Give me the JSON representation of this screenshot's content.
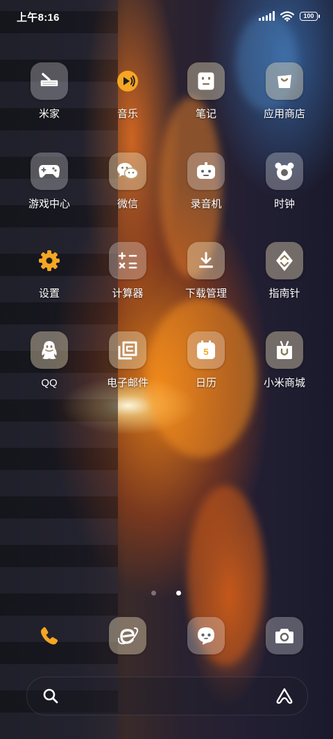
{
  "status_bar": {
    "time": "上午8:16",
    "battery": "100"
  },
  "apps": [
    {
      "label": "米家",
      "icon": "mijia-icon"
    },
    {
      "label": "音乐",
      "icon": "music-icon"
    },
    {
      "label": "笔记",
      "icon": "notes-icon"
    },
    {
      "label": "应用商店",
      "icon": "app-store-icon"
    },
    {
      "label": "游戏中心",
      "icon": "game-center-icon"
    },
    {
      "label": "微信",
      "icon": "wechat-icon"
    },
    {
      "label": "录音机",
      "icon": "recorder-icon"
    },
    {
      "label": "时钟",
      "icon": "clock-icon"
    },
    {
      "label": "设置",
      "icon": "settings-icon"
    },
    {
      "label": "计算器",
      "icon": "calculator-icon"
    },
    {
      "label": "下载管理",
      "icon": "download-manager-icon"
    },
    {
      "label": "指南针",
      "icon": "compass-icon"
    },
    {
      "label": "QQ",
      "icon": "qq-icon"
    },
    {
      "label": "电子邮件",
      "icon": "email-icon"
    },
    {
      "label": "日历",
      "icon": "calendar-icon",
      "day": "5"
    },
    {
      "label": "小米商城",
      "icon": "mi-store-icon"
    }
  ],
  "page_indicator": {
    "pages": 2,
    "current": 2
  },
  "dock": [
    {
      "icon": "phone-icon"
    },
    {
      "icon": "browser-icon"
    },
    {
      "icon": "messages-icon"
    },
    {
      "icon": "camera-icon"
    }
  ],
  "search_bar": {
    "search_icon": "search-icon",
    "assistant_icon": "assistant-icon"
  },
  "colors": {
    "accent_orange": "#f5a623",
    "icon_glass": "rgba(236,236,240,0.30)"
  }
}
